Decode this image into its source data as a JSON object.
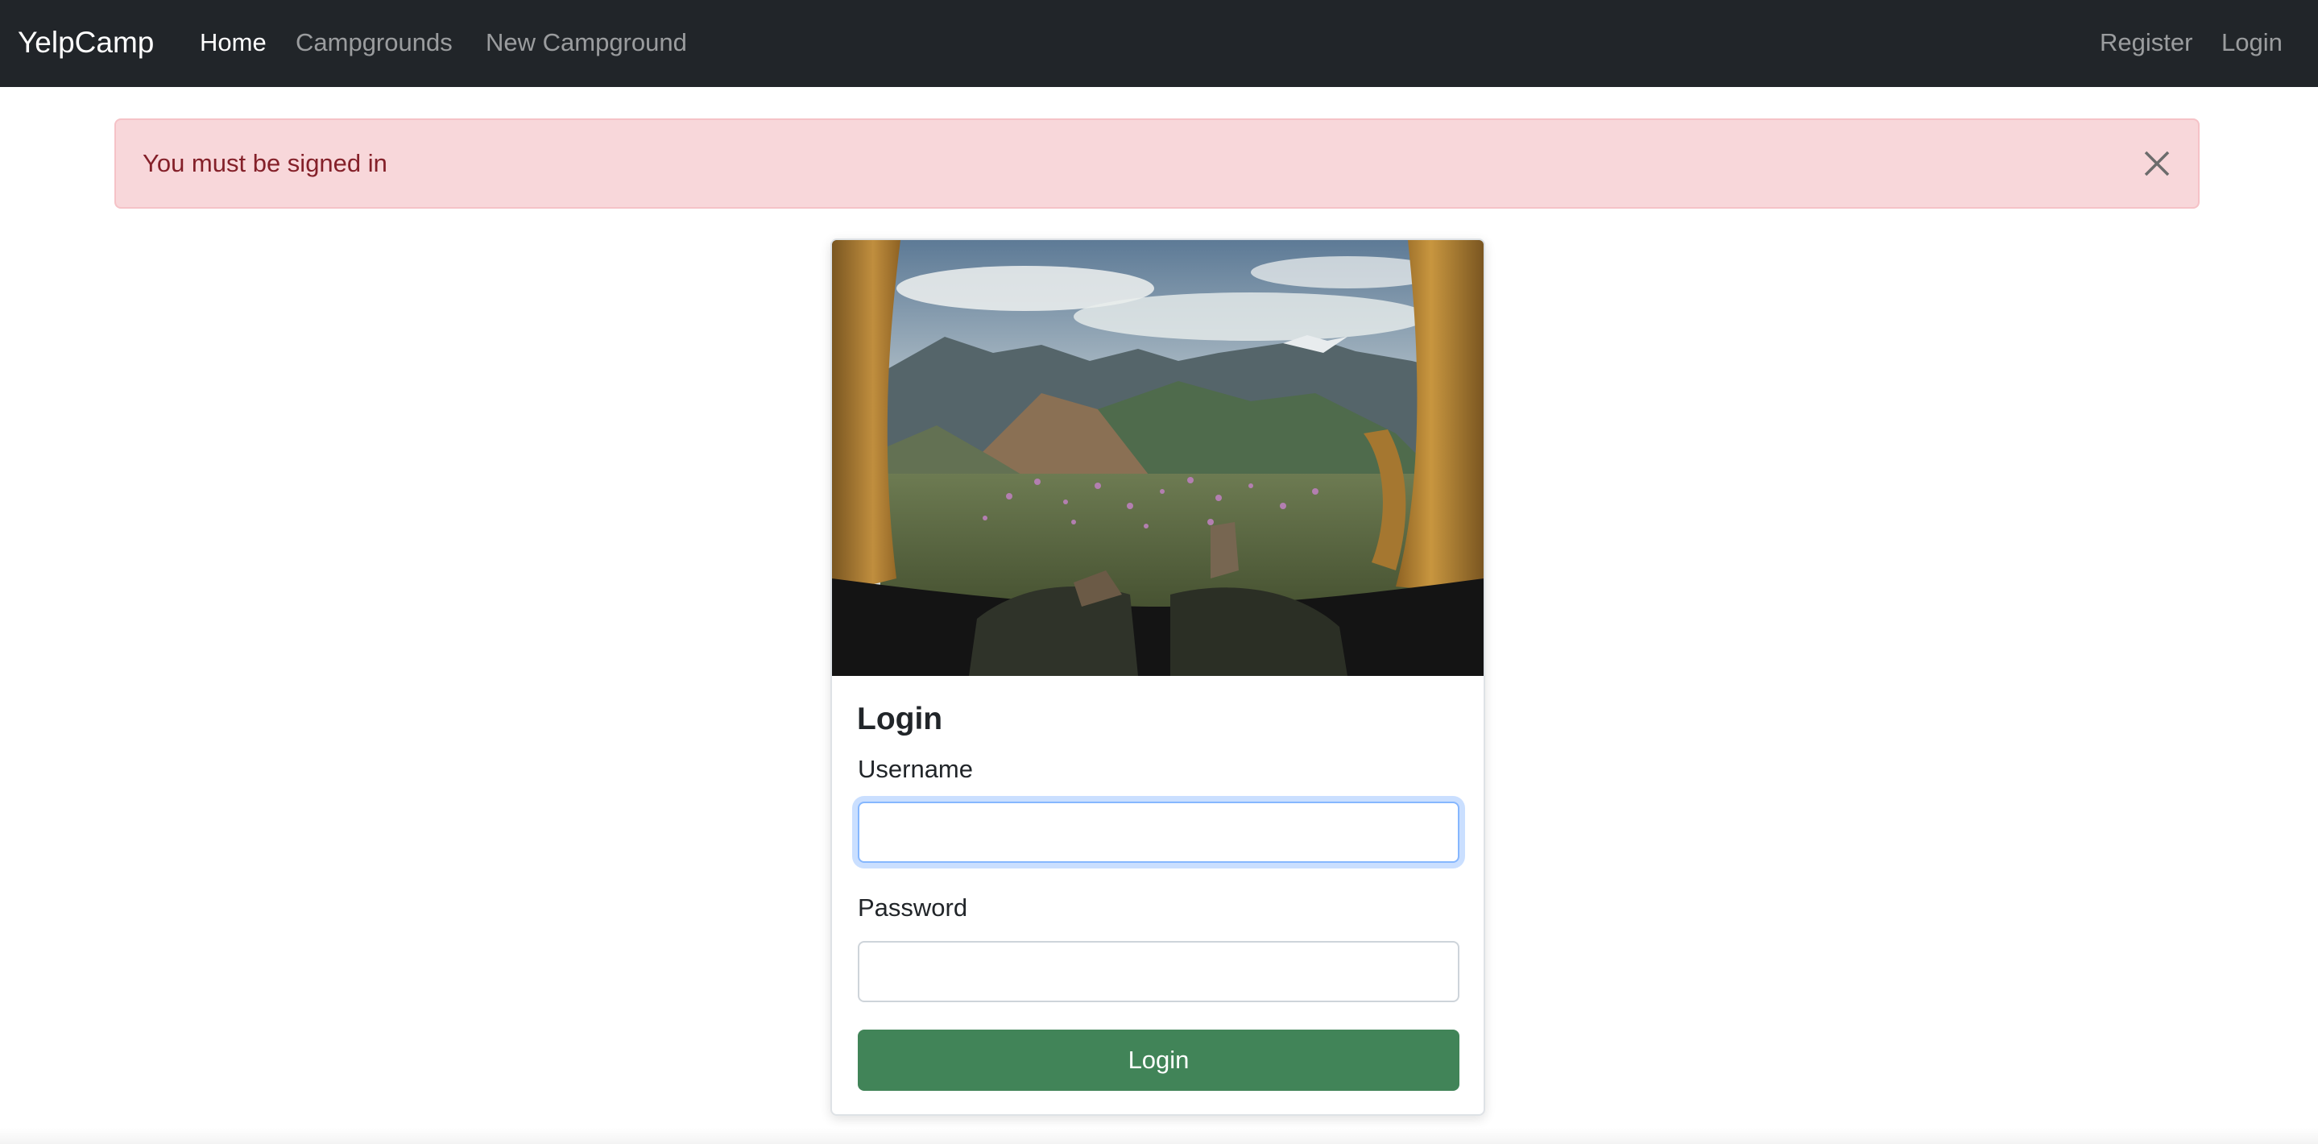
{
  "nav": {
    "brand": "YelpCamp",
    "links": [
      {
        "label": "Home",
        "active": true
      },
      {
        "label": "Campgrounds",
        "active": false
      },
      {
        "label": "New Campground",
        "active": false
      }
    ],
    "right_links": [
      {
        "label": "Register"
      },
      {
        "label": "Login"
      }
    ]
  },
  "alert": {
    "message": "You must be signed in",
    "close_icon": "close-icon",
    "variant": "danger"
  },
  "login_card": {
    "title": "Login",
    "username_label": "Username",
    "username_value": "",
    "password_label": "Password",
    "password_value": "",
    "submit_label": "Login",
    "image": "tent-mountain-view-photo"
  },
  "colors": {
    "navbar_bg": "#212529",
    "alert_bg": "#f8d7da",
    "alert_text": "#842029",
    "submit_bg": "#418458"
  }
}
